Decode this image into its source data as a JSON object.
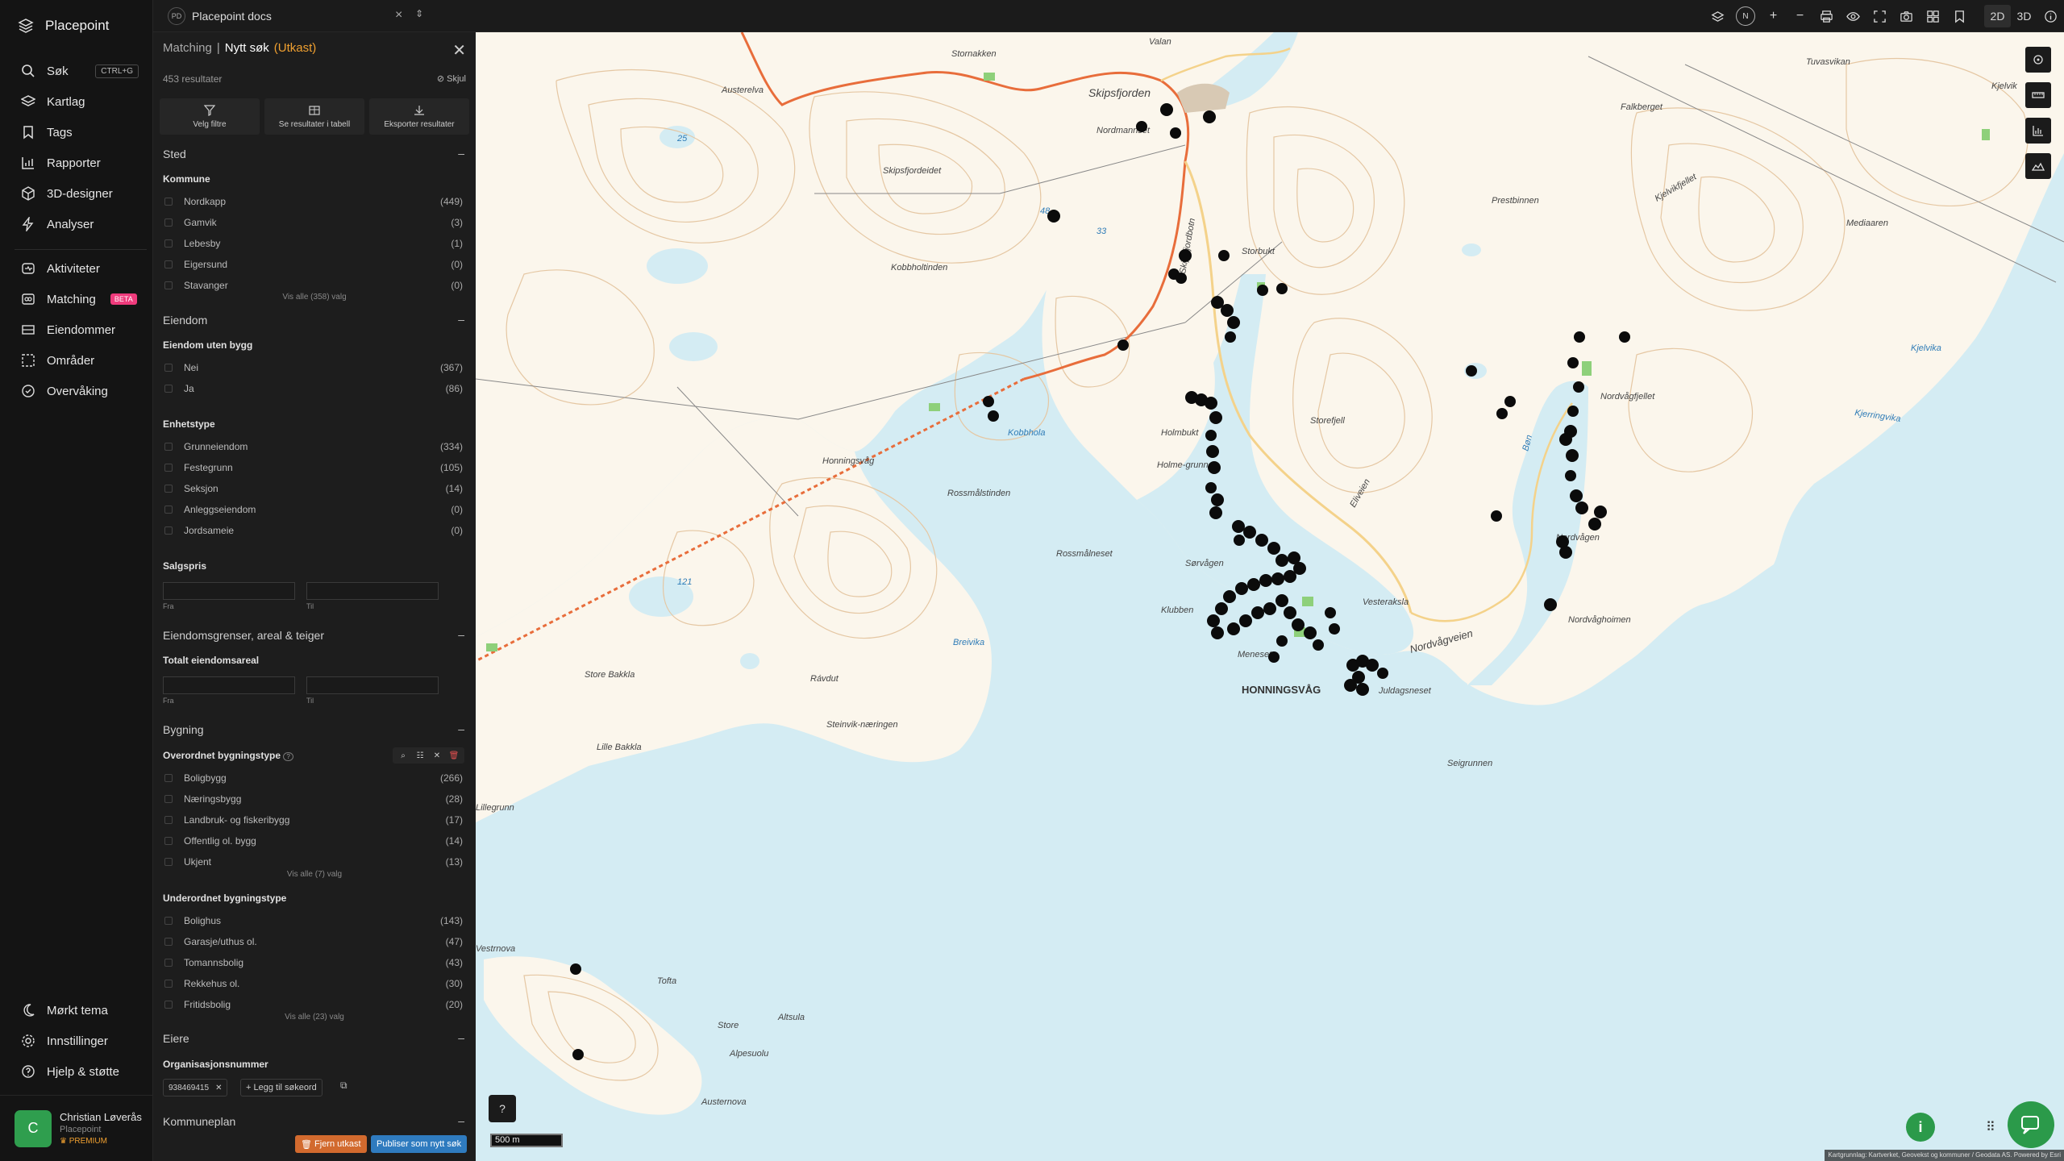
{
  "app": {
    "name": "Placepoint"
  },
  "nav": {
    "items": [
      {
        "label": "Søk",
        "kbd": "CTRL+G",
        "icon": "search-icon"
      },
      {
        "label": "Kartlag",
        "icon": "layers-icon"
      },
      {
        "label": "Tags",
        "icon": "bookmark-icon"
      },
      {
        "label": "Rapporter",
        "icon": "bar-chart-icon"
      },
      {
        "label": "3D-designer",
        "icon": "cube-icon"
      },
      {
        "label": "Analyser",
        "icon": "bolt-icon"
      }
    ],
    "items2": [
      {
        "label": "Aktiviteter",
        "icon": "activity-icon"
      },
      {
        "label": "Matching",
        "badge": "BETA",
        "icon": "matching-icon"
      },
      {
        "label": "Eiendommer",
        "icon": "property-icon"
      },
      {
        "label": "Områder",
        "icon": "area-icon"
      },
      {
        "label": "Overvåking",
        "icon": "monitor-icon"
      }
    ],
    "items3": [
      {
        "label": "Mørkt tema",
        "icon": "moon-icon"
      },
      {
        "label": "Innstillinger",
        "icon": "gear-icon"
      },
      {
        "label": "Hjelp & støtte",
        "icon": "help-icon"
      }
    ]
  },
  "user": {
    "initial": "C",
    "name": "Christian Løverås",
    "org": "Placepoint",
    "plan": "PREMIUM"
  },
  "topbar": {
    "doc_badge": "PD",
    "doc_title": "Placepoint docs",
    "compass": "N",
    "mode_2d": "2D",
    "mode_3d": "3D"
  },
  "panel": {
    "crumb1": "Matching",
    "sep": "|",
    "crumb2": "Nytt søk",
    "draft": "(Utkast)",
    "results": "453 resultater",
    "hide": "Skjul",
    "actions": [
      "Velg filtre",
      "Se resultater i tabell",
      "Eksporter resultater"
    ],
    "sted": {
      "title": "Sted",
      "label": "Kommune",
      "rows": [
        [
          "Nordkapp",
          "(449)"
        ],
        [
          "Gamvik",
          "(3)"
        ],
        [
          "Lebesby",
          "(1)"
        ],
        [
          "Eigersund",
          "(0)"
        ],
        [
          "Stavanger",
          "(0)"
        ]
      ],
      "more": "Vis alle (358) valg"
    },
    "eiendom": {
      "title": "Eiendom",
      "label": "Eiendom uten bygg",
      "rows": [
        [
          "Nei",
          "(367)"
        ],
        [
          "Ja",
          "(86)"
        ]
      ],
      "label2": "Enhetstype",
      "rows2": [
        [
          "Grunneiendom",
          "(334)"
        ],
        [
          "Festegrunn",
          "(105)"
        ],
        [
          "Seksjon",
          "(14)"
        ],
        [
          "Anleggseiendom",
          "(0)"
        ],
        [
          "Jordsameie",
          "(0)"
        ]
      ],
      "label3": "Salgspris",
      "from": "Fra",
      "to": "Til",
      "placeholder": "..."
    },
    "grenser": {
      "title": "Eiendomsgrenser, areal & teiger",
      "label": "Totalt eiendomsareal",
      "from": "Fra",
      "to": "Til"
    },
    "bygning": {
      "title": "Bygning",
      "label": "Overordnet bygningstype",
      "rows": [
        [
          "Boligbygg",
          "(266)"
        ],
        [
          "Næringsbygg",
          "(28)"
        ],
        [
          "Landbruk- og fiskeribygg",
          "(17)"
        ],
        [
          "Offentlig ol. bygg",
          "(14)"
        ],
        [
          "Ukjent",
          "(13)"
        ]
      ],
      "more": "Vis alle (7) valg",
      "label2": "Underordnet bygningstype",
      "rows2": [
        [
          "Bolighus",
          "(143)"
        ],
        [
          "Garasje/uthus ol.",
          "(47)"
        ],
        [
          "Tomannsbolig",
          "(43)"
        ],
        [
          "Rekkehus ol.",
          "(30)"
        ],
        [
          "Fritidsbolig",
          "(20)"
        ]
      ],
      "more2": "Vis alle (23) valg"
    },
    "eiere": {
      "title": "Eiere",
      "label": "Organisasjonsnummer",
      "chip": "938469415",
      "add": "Legg til søkeord"
    },
    "kommuneplan": {
      "title": "Kommuneplan"
    },
    "btn_remove": "Fjern utkast",
    "btn_publish": "Publiser som nytt søk"
  },
  "map": {
    "labels": [
      "Stornakken",
      "Valan",
      "Skipsfjorden",
      "Austerelva",
      "Nordmannset",
      "Skipsfjordeidet",
      "Skipsfjordbotn",
      "Kobbhola",
      "Honningsvåg",
      "Rossmålstinden",
      "Rossmålneset",
      "Holmbukt",
      "Holme-grunnen",
      "Storbukt",
      "Storefjell",
      "Eliveien",
      "Sørvågen",
      "Klubben",
      "Meneset",
      "HONNINGSVÅG",
      "Nordvågveien",
      "Juldagsneset",
      "Vesteraksla",
      "Breivika",
      "Rávdut",
      "Steinvik-næringen",
      "Store Bakkla",
      "Lille Bakkla",
      "Seigrunnen",
      "Nordvåghoimen",
      "Nordvågen",
      "Nordvågfjellet",
      "Kjerringvika",
      "Kjelvikfjellet",
      "Mediaaren",
      "Prestbinnen",
      "Falkberget",
      "Kjelvik",
      "Kjelvika",
      "Tuvasvikan",
      "Kobbholtinden",
      "Bøn",
      "Tofta",
      "Store",
      "Altsula",
      "Alpesuolu",
      "Austernova",
      "Vestrnova",
      "Lillegrunn"
    ],
    "numbers": [
      "25",
      "33",
      "121",
      "48"
    ],
    "scale": "500 m",
    "attribution": "Kartgrunnlag: Kartverket, Geovekst og kommuner / Geodata AS. Powered by Esri"
  },
  "icons": {
    "accent": "#f0a030",
    "publish": "#2f7bbf",
    "remove": "#d26a2e",
    "green": "#2b9a4a"
  }
}
